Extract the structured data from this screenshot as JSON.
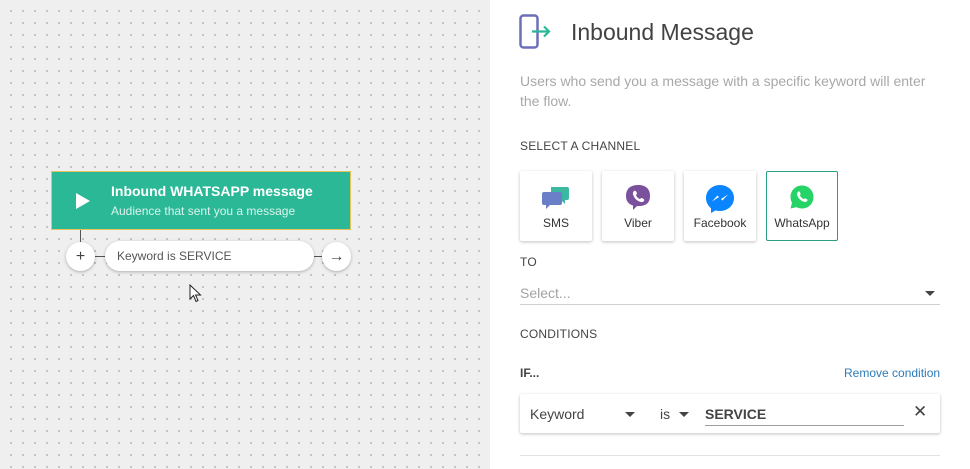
{
  "canvas": {
    "node": {
      "title": "Inbound WHATSAPP message",
      "subtitle": "Audience that sent you a message",
      "icon": "play-icon"
    },
    "condition_pill": "Keyword is SERVICE",
    "add_symbol": "+",
    "next_symbol": "→"
  },
  "panel": {
    "title": "Inbound Message",
    "description": "Users who send you a message with a specific keyword will enter the flow.",
    "select_channel_label": "SELECT A CHANNEL",
    "channels": [
      {
        "label": "SMS",
        "icon": "sms-icon",
        "color": "#6a7fc7",
        "active": false
      },
      {
        "label": "Viber",
        "icon": "viber-icon",
        "color": "#7b519d",
        "active": false
      },
      {
        "label": "Facebook",
        "icon": "messenger-icon",
        "color": "#0b84ff",
        "active": false
      },
      {
        "label": "WhatsApp",
        "icon": "whatsapp-icon",
        "color": "#25d366",
        "active": true
      }
    ],
    "to_label": "TO",
    "to_placeholder": "Select...",
    "conditions_label": "CONDITIONS",
    "if_label": "IF...",
    "remove_condition": "Remove condition",
    "condition": {
      "field": "Keyword",
      "operator": "is",
      "value": "SERVICE",
      "remove_symbol": "✕"
    }
  },
  "colors": {
    "accent_green": "#2ab897",
    "active_border": "#2a9d84",
    "link_blue": "#2d7bb8",
    "inbound_icon_purple": "#6c6fb8"
  }
}
